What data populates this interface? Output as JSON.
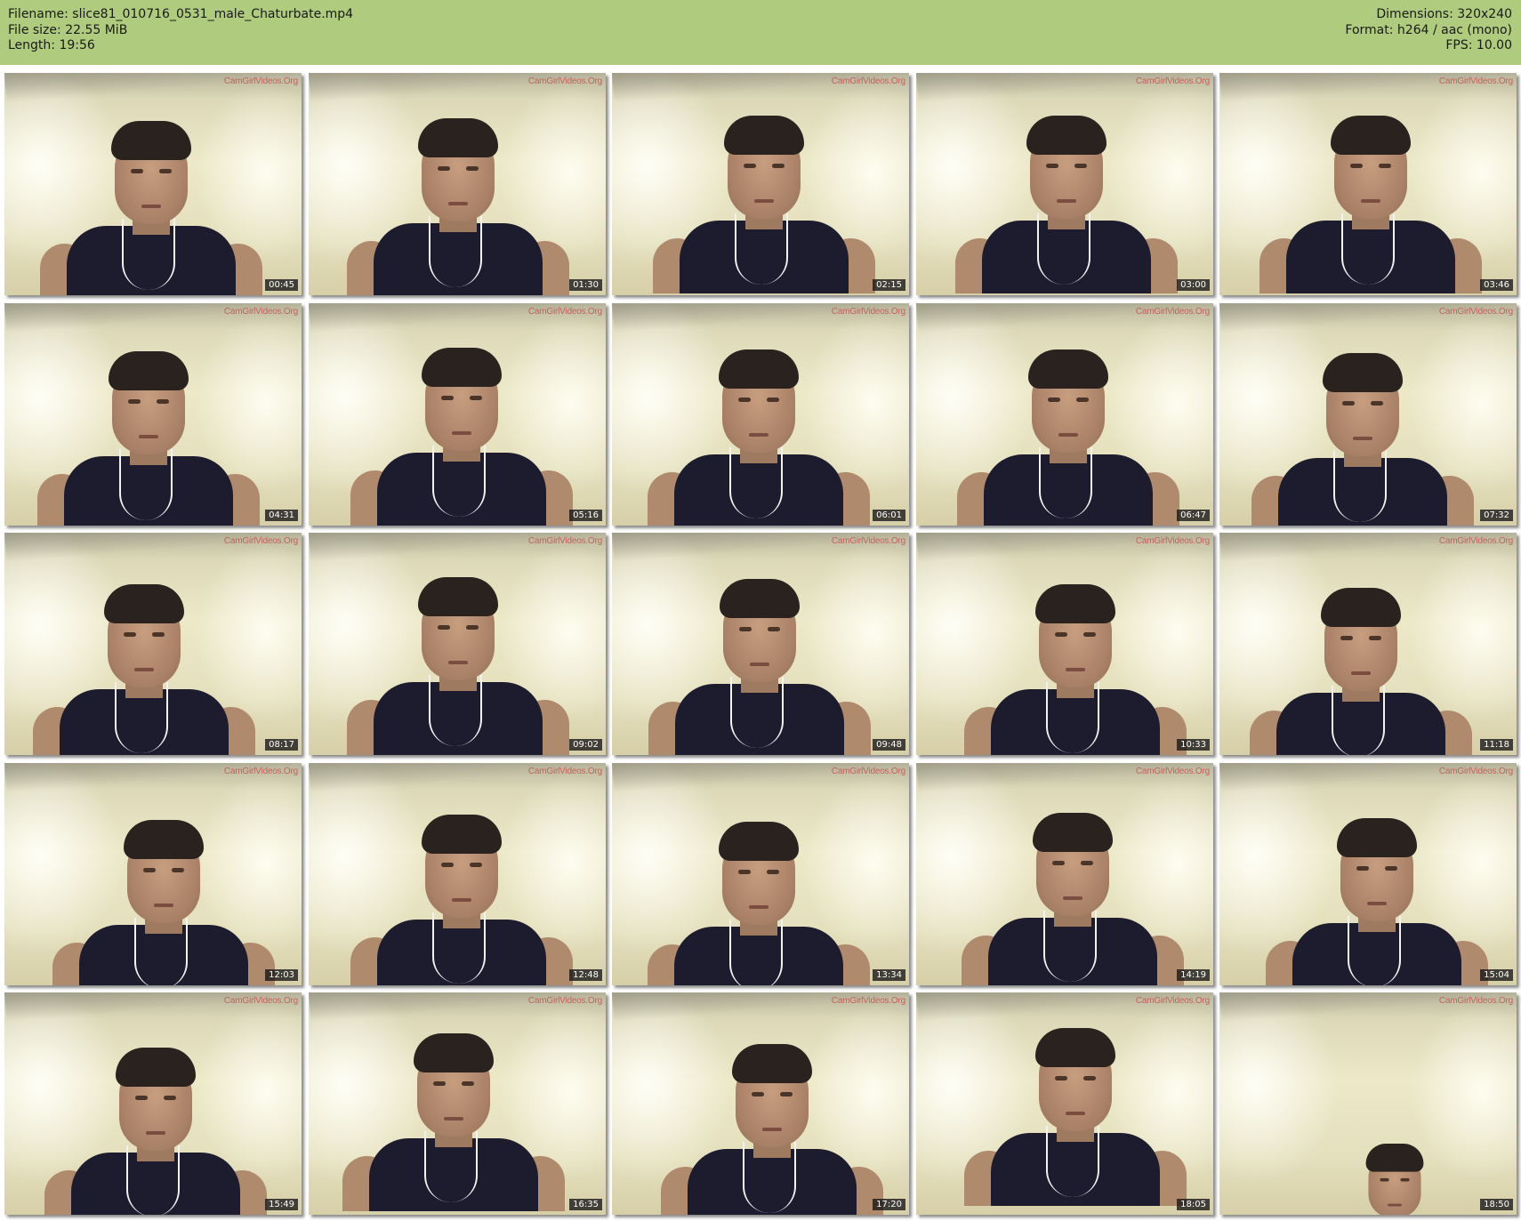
{
  "header": {
    "filename_label": "Filename: slice81_010716_0531_male_Chaturbate.mp4",
    "filesize_label": "File size: 22.55 MiB",
    "length_label": "Length: 19:56",
    "dimensions_label": "Dimensions: 320x240",
    "format_label": "Format: h264 / aac (mono)",
    "fps_label": "FPS: 10.00",
    "background_color": "#afcb7e"
  },
  "watermark_text": "CamGirlVideos.Org",
  "thumbnails": [
    {
      "time": "00:45"
    },
    {
      "time": "01:30"
    },
    {
      "time": "02:15"
    },
    {
      "time": "03:00"
    },
    {
      "time": "03:46"
    },
    {
      "time": "04:31"
    },
    {
      "time": "05:16"
    },
    {
      "time": "06:01"
    },
    {
      "time": "06:47"
    },
    {
      "time": "07:32"
    },
    {
      "time": "08:17"
    },
    {
      "time": "09:02"
    },
    {
      "time": "09:48"
    },
    {
      "time": "10:33"
    },
    {
      "time": "11:18"
    },
    {
      "time": "12:03"
    },
    {
      "time": "12:48"
    },
    {
      "time": "13:34"
    },
    {
      "time": "14:19"
    },
    {
      "time": "15:04"
    },
    {
      "time": "15:49"
    },
    {
      "time": "16:35"
    },
    {
      "time": "17:20"
    },
    {
      "time": "18:05"
    },
    {
      "time": "18:50"
    }
  ]
}
